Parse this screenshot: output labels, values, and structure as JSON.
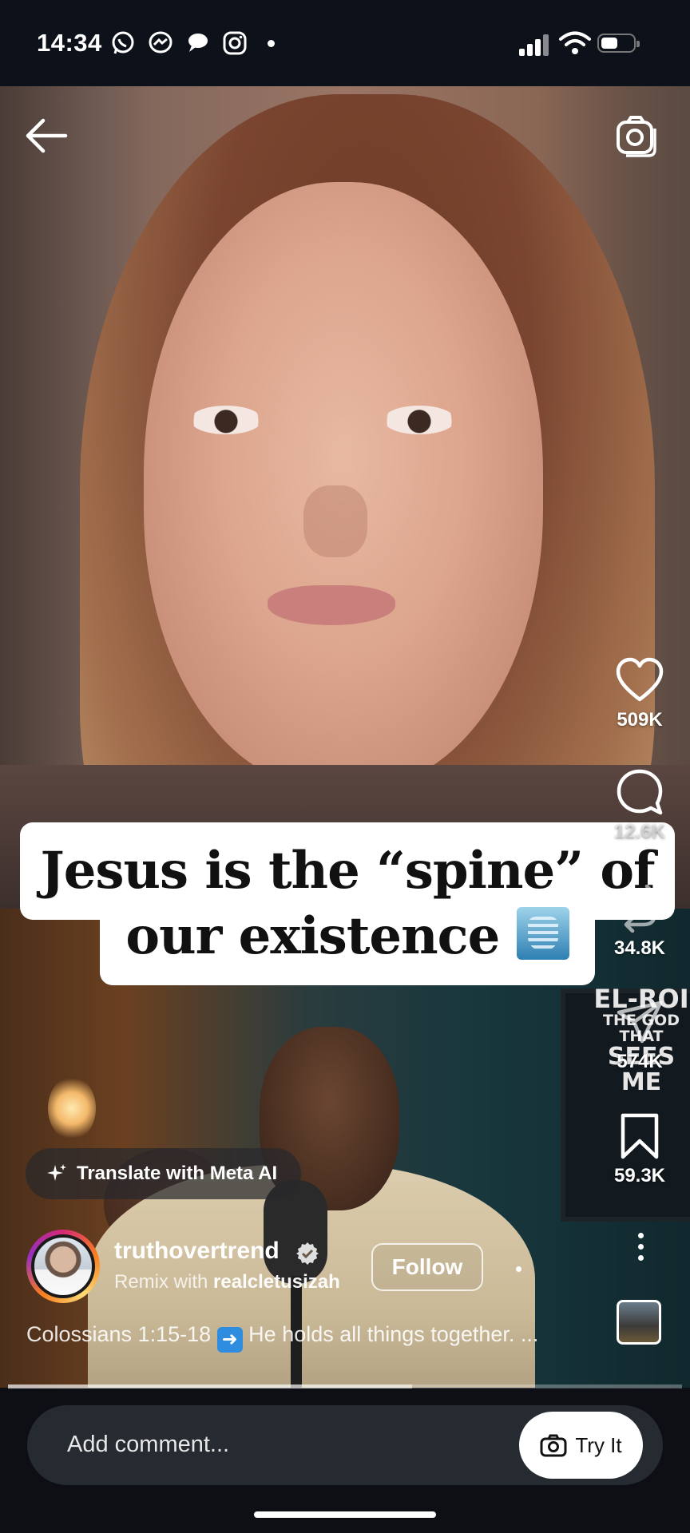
{
  "status_bar": {
    "time": "14:34",
    "notification_icons": [
      "whatsapp-icon",
      "messenger-icon",
      "chat-bubble-icon",
      "instagram-icon"
    ],
    "system_icons": [
      "signal-icon",
      "wifi-icon",
      "battery-icon"
    ]
  },
  "header": {
    "back_icon": "back-arrow-icon",
    "camera_icon": "camera-icon"
  },
  "video": {
    "overlay_caption": "Jesus is the “spine” of our existence",
    "overlay_caption_line1": "Jesus is the “spine” of",
    "overlay_caption_line2": "our existence",
    "background_sign": [
      "EL-ROI",
      "THE GOD THAT",
      "SEES ME"
    ],
    "progress_fraction": 0.6
  },
  "actions": {
    "likes": "509K",
    "comments": "12.6K",
    "remixes": "34.8K",
    "shares": "574K",
    "saves": "59.3K"
  },
  "translate": {
    "label": "Translate with Meta AI"
  },
  "author": {
    "username": "truthovertrend",
    "verified": true,
    "remix_prefix": "Remix with",
    "remix_user": "realcletusizah",
    "follow_label": "Follow"
  },
  "caption": {
    "reference": "Colossians 1:15-18",
    "arrow": "➡️",
    "text": "He holds all things together. ..."
  },
  "comment_bar": {
    "placeholder": "Add comment...",
    "try_label": "Try It"
  },
  "colors": {
    "background": "#0d0f14",
    "comment_field": "#262a31",
    "caption_banner": "#ffffff"
  }
}
